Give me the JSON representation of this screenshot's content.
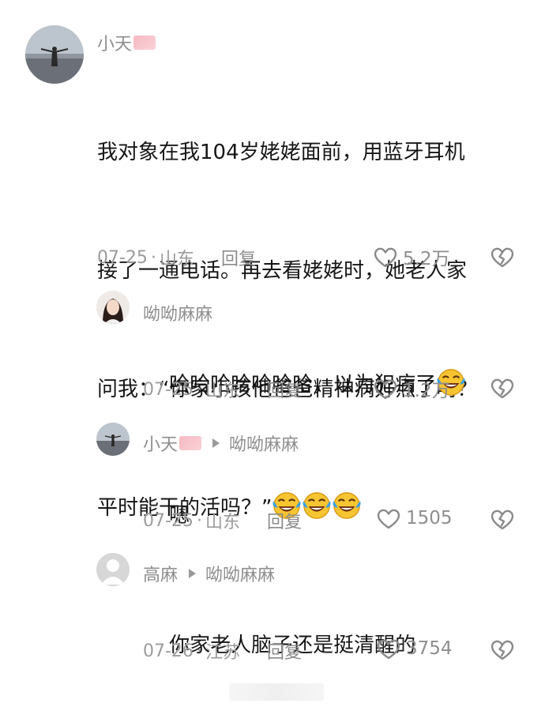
{
  "comments": [
    {
      "user": "小天",
      "text_lines": [
        "我对象在我104岁姥姥面前，用蓝牙耳机",
        "接了一通电话。再去看姥姥时，她老人家",
        "问我：“你家小孩他爸爸精神病好点了吗？",
        "平时能干的活吗？”"
      ],
      "emoji": [
        "laugh-cry-emoji",
        "laugh-cry-emoji",
        "laugh-cry-emoji"
      ],
      "date": "07-25",
      "location": "山东",
      "reply_label": "回复",
      "likes": "5.2万"
    },
    {
      "user": "呦呦麻麻",
      "text": "哈哈哈哈哈哈哈，以为犯病了",
      "emoji": [
        "laugh-cry-emoji"
      ],
      "date": "07-25",
      "location": "山东",
      "reply_label": "回复",
      "likes": "1.2万"
    },
    {
      "user": "小天",
      "reply_to": "呦呦麻麻",
      "text": "嗯",
      "date": "07-25",
      "location": "山东",
      "reply_label": "回复",
      "likes": "1505"
    },
    {
      "user": "高麻",
      "reply_to": "呦呦麻麻",
      "text": "你家老人脑子还是挺清醒的",
      "date": "07-26",
      "location": "江苏",
      "reply_label": "回复",
      "likes": "3754"
    }
  ],
  "separator": "·",
  "colors": {
    "text": "#161616",
    "meta": "#9b9b9b",
    "emoji": "#f7c531",
    "tears": "#3aa0e8"
  }
}
